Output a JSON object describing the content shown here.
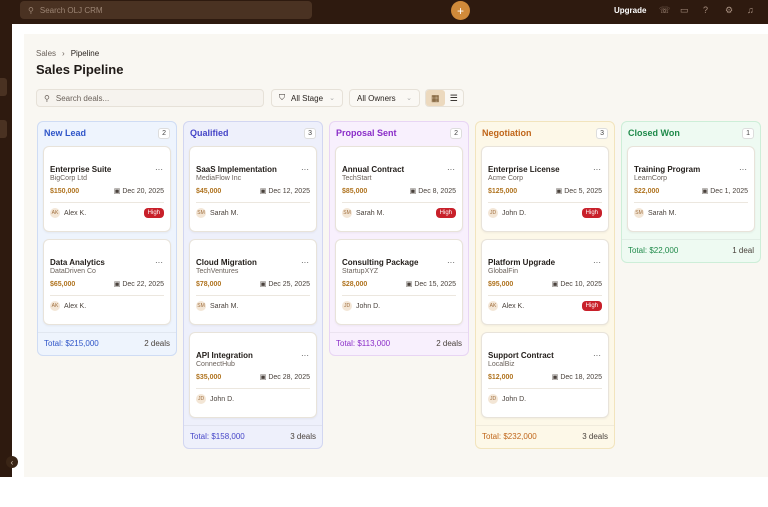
{
  "topbar": {
    "search_placeholder": "Search OLJ CRM",
    "upgrade": "Upgrade",
    "icons": [
      "phone-icon",
      "chat-icon",
      "help-icon",
      "settings-icon",
      "bell-icon"
    ]
  },
  "breadcrumb": [
    "Sales",
    "Pipeline"
  ],
  "title": "Sales Pipeline",
  "toolbar": {
    "search_placeholder": "Search deals...",
    "stage": "All Stage",
    "owners": "All Owners"
  },
  "colors": {
    "accent": "#d08a3a",
    "high": "#c8202a"
  },
  "columns": [
    {
      "name": "New Lead",
      "count": "2",
      "color": "#2f55c8",
      "bg": "#eef4fd",
      "border": "#cfdcf4",
      "total": "Total: $215,000",
      "deals": "2 deals",
      "cards": [
        {
          "title": "Enterprise Suite",
          "company": "BigCorp Ltd",
          "amount": "$150,000",
          "date": "Dec 20, 2025",
          "initials": "AK",
          "owner": "Alex K.",
          "priority": "High"
        },
        {
          "title": "Data Analytics",
          "company": "DataDriven Co",
          "amount": "$65,000",
          "date": "Dec 22, 2025",
          "initials": "AK",
          "owner": "Alex K."
        }
      ]
    },
    {
      "name": "Qualified",
      "count": "3",
      "color": "#4646c8",
      "bg": "#eef0fb",
      "border": "#d2d6f1",
      "total": "Total: $158,000",
      "deals": "3 deals",
      "cards": [
        {
          "title": "SaaS Implementation",
          "company": "MediaFlow Inc",
          "amount": "$45,000",
          "date": "Dec 12, 2025",
          "initials": "SM",
          "owner": "Sarah M."
        },
        {
          "title": "Cloud Migration",
          "company": "TechVentures",
          "amount": "$78,000",
          "date": "Dec 25, 2025",
          "initials": "SM",
          "owner": "Sarah M."
        },
        {
          "title": "API Integration",
          "company": "ConnectHub",
          "amount": "$35,000",
          "date": "Dec 28, 2025",
          "initials": "JD",
          "owner": "John D."
        }
      ]
    },
    {
      "name": "Proposal Sent",
      "count": "2",
      "color": "#8a2dc8",
      "bg": "#f8f0fd",
      "border": "#e8d5f4",
      "total": "Total: $113,000",
      "deals": "2 deals",
      "cards": [
        {
          "title": "Annual Contract",
          "company": "TechStart",
          "amount": "$85,000",
          "date": "Dec 8, 2025",
          "initials": "SM",
          "owner": "Sarah M.",
          "priority": "High"
        },
        {
          "title": "Consulting Package",
          "company": "StartupXYZ",
          "amount": "$28,000",
          "date": "Dec 15, 2025",
          "initials": "JD",
          "owner": "John D."
        }
      ]
    },
    {
      "name": "Negotiation",
      "count": "3",
      "color": "#c0661a",
      "bg": "#fdf8e8",
      "border": "#f2e4bd",
      "total": "Total: $232,000",
      "deals": "3 deals",
      "cards": [
        {
          "title": "Enterprise License",
          "company": "Acme Corp",
          "amount": "$125,000",
          "date": "Dec 5, 2025",
          "initials": "JD",
          "owner": "John D.",
          "priority": "High"
        },
        {
          "title": "Platform Upgrade",
          "company": "GlobalFin",
          "amount": "$95,000",
          "date": "Dec 10, 2025",
          "initials": "AK",
          "owner": "Alex K.",
          "priority": "High"
        },
        {
          "title": "Support Contract",
          "company": "LocalBiz",
          "amount": "$12,000",
          "date": "Dec 18, 2025",
          "initials": "JD",
          "owner": "John D."
        }
      ]
    },
    {
      "name": "Closed Won",
      "count": "1",
      "color": "#1f8a4a",
      "bg": "#eefaf2",
      "border": "#cdeed8",
      "total": "Total: $22,000",
      "deals": "1 deal",
      "cards": [
        {
          "title": "Training Program",
          "company": "LearnCorp",
          "amount": "$22,000",
          "date": "Dec 1, 2025",
          "initials": "SM",
          "owner": "Sarah M."
        }
      ]
    }
  ]
}
